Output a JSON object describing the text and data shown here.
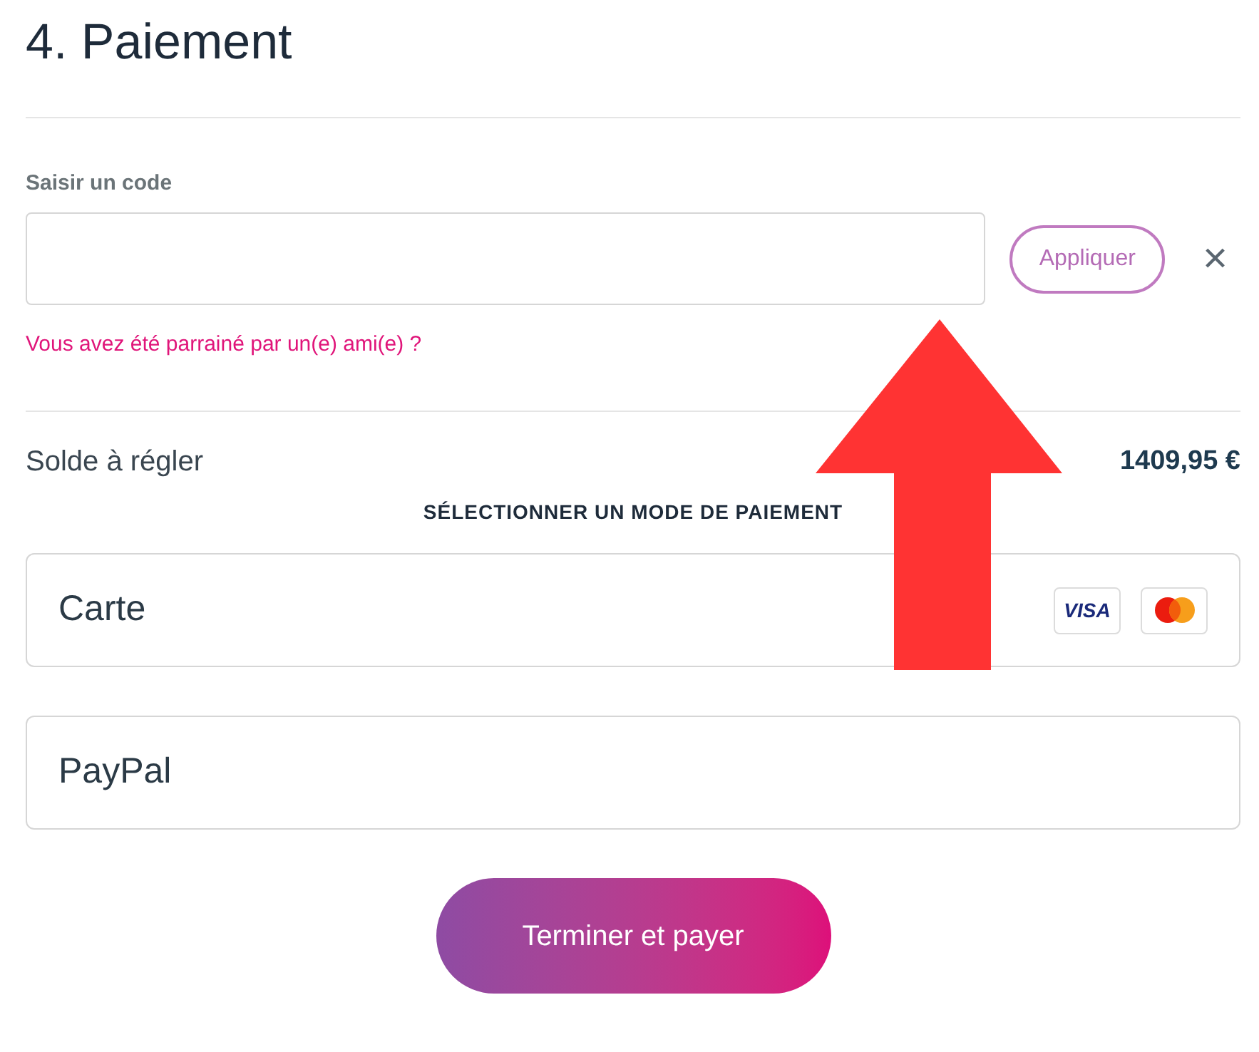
{
  "title": "4. Paiement",
  "code": {
    "label": "Saisir un code",
    "apply_button": "Appliquer",
    "close": "×",
    "referral_link": "Vous avez été parrainé par un(e) ami(e) ?"
  },
  "balance": {
    "label": "Solde à régler",
    "amount": "1409,95 €"
  },
  "payment_heading": "SÉLECTIONNER UN MODE DE PAIEMENT",
  "payment_methods": [
    {
      "label": "Carte",
      "brands": [
        {
          "kind": "visa",
          "label": "VISA"
        },
        {
          "kind": "mastercard"
        }
      ]
    },
    {
      "label": "PayPal"
    }
  ],
  "submit_button": "Terminer et payer",
  "annotation": {
    "kind": "arrow-up"
  }
}
